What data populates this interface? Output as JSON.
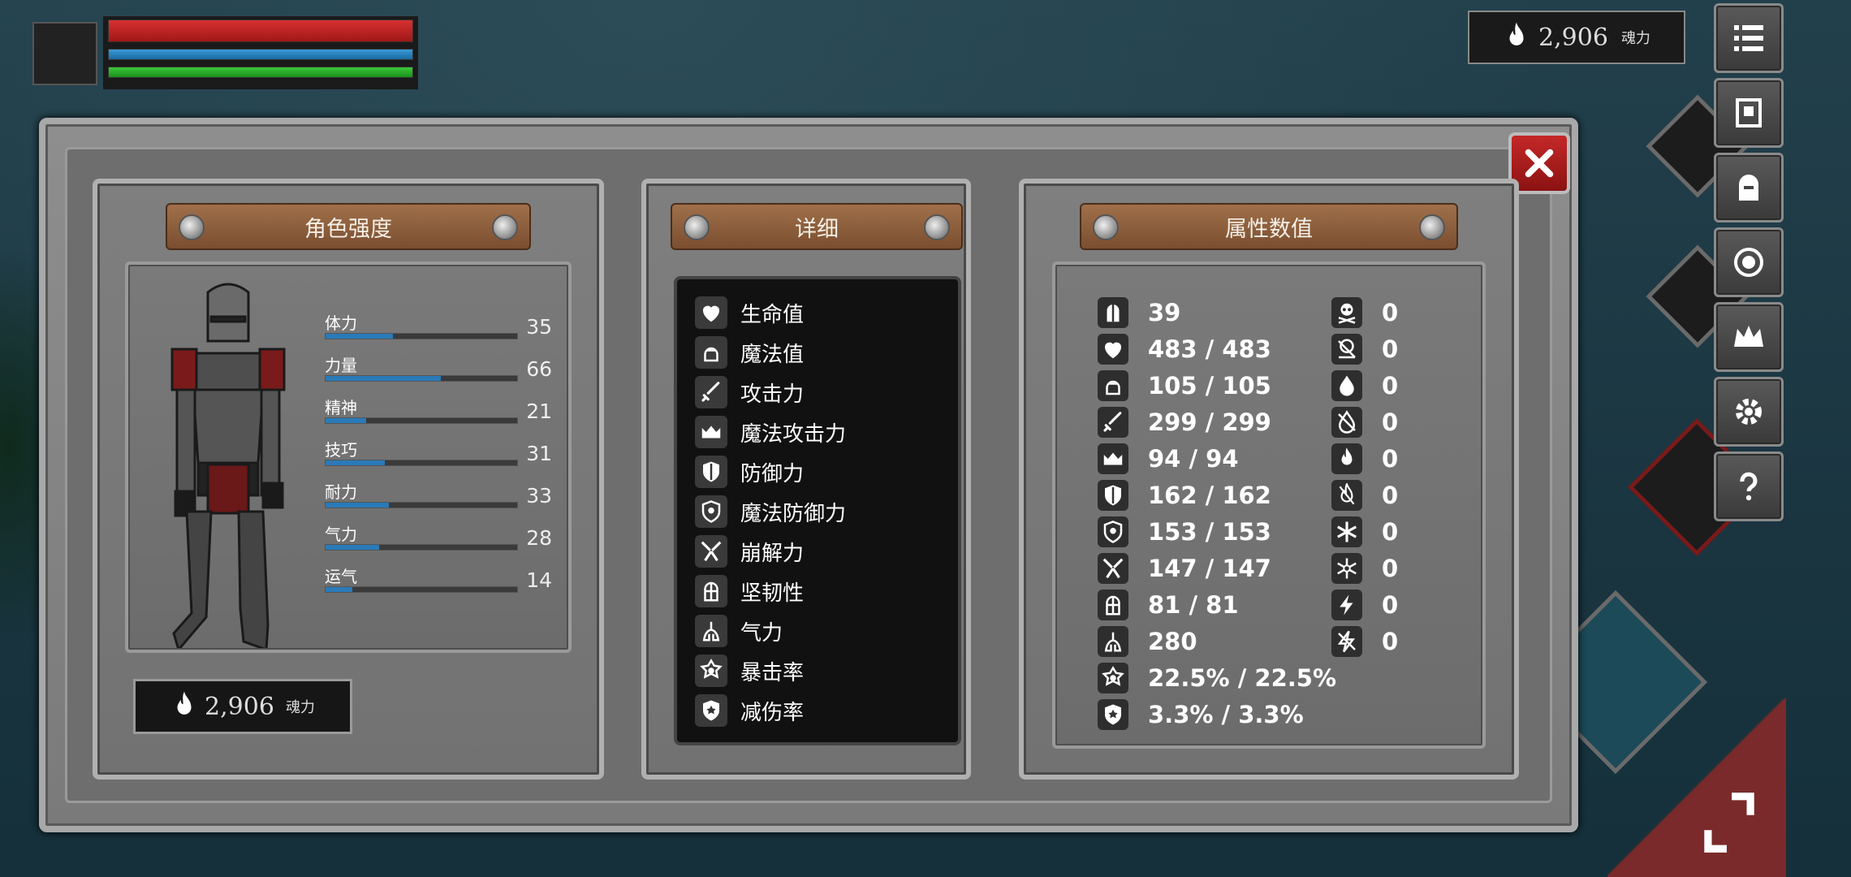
{
  "hud": {
    "soul_top": {
      "value": "2,906",
      "unit": "魂力"
    }
  },
  "panels": {
    "character": {
      "title": "角色强度",
      "stats": [
        {
          "label": "体力",
          "value": "35",
          "fill": 0.35
        },
        {
          "label": "力量",
          "value": "66",
          "fill": 0.6
        },
        {
          "label": "精神",
          "value": "21",
          "fill": 0.21
        },
        {
          "label": "技巧",
          "value": "31",
          "fill": 0.31
        },
        {
          "label": "耐力",
          "value": "33",
          "fill": 0.33
        },
        {
          "label": "气力",
          "value": "28",
          "fill": 0.28
        },
        {
          "label": "运气",
          "value": "14",
          "fill": 0.14
        }
      ],
      "soul": {
        "value": "2,906",
        "unit": "魂力"
      }
    },
    "detail": {
      "title": "详细",
      "items": [
        {
          "icon": "heart-icon",
          "label": "生命值"
        },
        {
          "icon": "head-icon",
          "label": "魔法值"
        },
        {
          "icon": "sword-icon",
          "label": "攻击力"
        },
        {
          "icon": "spellbook-icon",
          "label": "魔法攻击力"
        },
        {
          "icon": "shield-icon",
          "label": "防御力"
        },
        {
          "icon": "magic-shield-icon",
          "label": "魔法防御力"
        },
        {
          "icon": "break-icon",
          "label": "崩解力"
        },
        {
          "icon": "helmet-icon",
          "label": "坚韧性"
        },
        {
          "icon": "lungs-icon",
          "label": "气力"
        },
        {
          "icon": "star-burst-icon",
          "label": "暴击率"
        },
        {
          "icon": "damage-reduction-icon",
          "label": "减伤率"
        }
      ]
    },
    "attributes": {
      "title": "属性数值",
      "left": [
        {
          "icon": "helmet-icon",
          "value": "39"
        },
        {
          "icon": "heart-icon",
          "value": "483 / 483"
        },
        {
          "icon": "head-icon",
          "value": "105 / 105"
        },
        {
          "icon": "sword-icon",
          "value": "299 / 299"
        },
        {
          "icon": "spellbook-icon",
          "value": "94 / 94"
        },
        {
          "icon": "shield-icon",
          "value": "162 / 162"
        },
        {
          "icon": "magic-shield-icon",
          "value": "153 / 153"
        },
        {
          "icon": "break-icon",
          "value": "147 / 147"
        },
        {
          "icon": "helmet-icon",
          "value": "81 / 81"
        },
        {
          "icon": "lungs-icon",
          "value": "280"
        },
        {
          "icon": "star-burst-icon",
          "value": "22.5% / 22.5%"
        },
        {
          "icon": "damage-reduction-icon",
          "value": "3.3% / 3.3%"
        }
      ],
      "right": [
        {
          "icon": "skull-icon",
          "value": "0"
        },
        {
          "icon": "skull-resist-icon",
          "value": "0"
        },
        {
          "icon": "blood-drop-icon",
          "value": "0"
        },
        {
          "icon": "blood-resist-icon",
          "value": "0"
        },
        {
          "icon": "fire-icon",
          "value": "0"
        },
        {
          "icon": "fire-resist-icon",
          "value": "0"
        },
        {
          "icon": "frost-icon",
          "value": "0"
        },
        {
          "icon": "frost-resist-icon",
          "value": "0"
        },
        {
          "icon": "lightning-icon",
          "value": "0"
        },
        {
          "icon": "lightning-resist-icon",
          "value": "0"
        }
      ]
    }
  }
}
